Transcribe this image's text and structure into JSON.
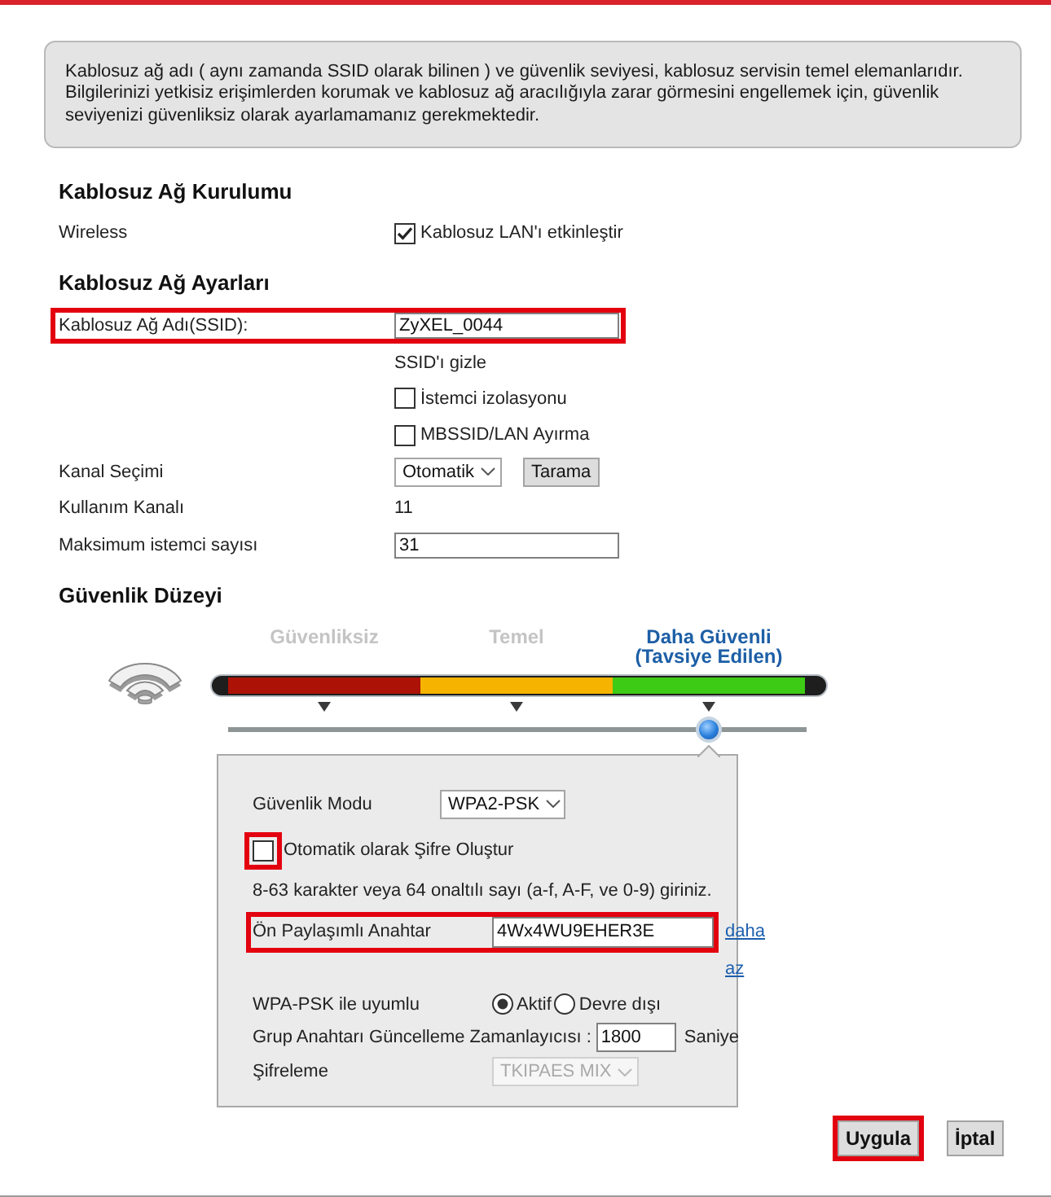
{
  "info_box": {
    "paragraphs": [
      "Kablosuz ağ adı ( aynı zamanda SSID olarak bilinen ) ve güvenlik seviyesi, kablosuz servisin temel elemanlarıdır.",
      "Bilgilerinizi yetkisiz erişimlerden korumak ve kablosuz ağ aracılığıyla zarar görmesini engellemek için, güvenlik seviyenizi güvenliksiz olarak ayarlamamanız gerekmektedir."
    ]
  },
  "setup": {
    "heading": "Kablosuz Ağ Kurulumu",
    "rows": [
      {
        "kind": "checkbox",
        "label": "Wireless",
        "text": "Kablosuz LAN'ı etkinleştir",
        "checked": true,
        "highlighted": false
      }
    ]
  },
  "settings": {
    "heading": "Kablosuz Ağ Ayarları",
    "rows": [
      {
        "kind": "input",
        "label": "Kablosuz Ağ Adı(SSID):",
        "value": "ZyXEL_0044",
        "highlighted": true
      },
      {
        "kind": "text",
        "text": "SSID'ı gizle",
        "highlighted": false
      },
      {
        "kind": "checkbox",
        "text": "İstemci izolasyonu",
        "checked": false,
        "highlighted": false
      },
      {
        "kind": "checkbox",
        "text": "MBSSID/LAN Ayırma",
        "checked": false,
        "highlighted": false
      },
      {
        "kind": "select",
        "label": "Kanal Seçimi",
        "value": "Otomatik",
        "button": "Tarama",
        "highlighted": false
      },
      {
        "kind": "value",
        "label": "Kullanım Kanalı",
        "value": "11",
        "highlighted": false
      },
      {
        "kind": "input",
        "label": "Maksimum istemci sayısı",
        "value": "31",
        "highlighted": false
      }
    ]
  },
  "security": {
    "heading": "Güvenlik Düzeyi",
    "levels": [
      {
        "label": "Güvenliksiz",
        "color": "#ad1206",
        "selected": false
      },
      {
        "label": "Temel",
        "color": "#f6b400",
        "selected": false
      },
      {
        "label": "Daha Güvenli (Tavsiye Edilen)",
        "color": "#3ecb15",
        "selected": true
      }
    ],
    "panel": {
      "mode": {
        "label": "Güvenlik Modu",
        "value": "WPA2-PSK",
        "disabled": false
      },
      "auto_password": {
        "text": "Otomatik olarak Şifre Oluştur",
        "checked": false,
        "highlighted": true
      },
      "hint": "8-63 karakter veya 64 onaltılı sayı (a-f, A-F, ve 0-9) giriniz.",
      "key": {
        "label": "Ön Paylaşımlı Anahtar",
        "value": "4Wx4WU9EHER3E",
        "link": "daha az",
        "highlighted": true
      },
      "wpa_compat": {
        "label": "WPA-PSK ile uyumlu",
        "options": [
          {
            "label": "Aktif",
            "selected": true
          },
          {
            "label": "Devre dışı",
            "selected": false
          }
        ]
      },
      "group_key_timer": {
        "label": "Grup Anahtarı Güncelleme Zamanlayıcısı :",
        "value": "1800",
        "unit": "Saniye"
      },
      "encryption": {
        "label": "Şifreleme",
        "value": "TKIPAES MIX",
        "disabled": true
      }
    }
  },
  "buttons": [
    {
      "label": "Uygula",
      "highlighted": true
    },
    {
      "label": "İptal",
      "highlighted": false
    }
  ]
}
